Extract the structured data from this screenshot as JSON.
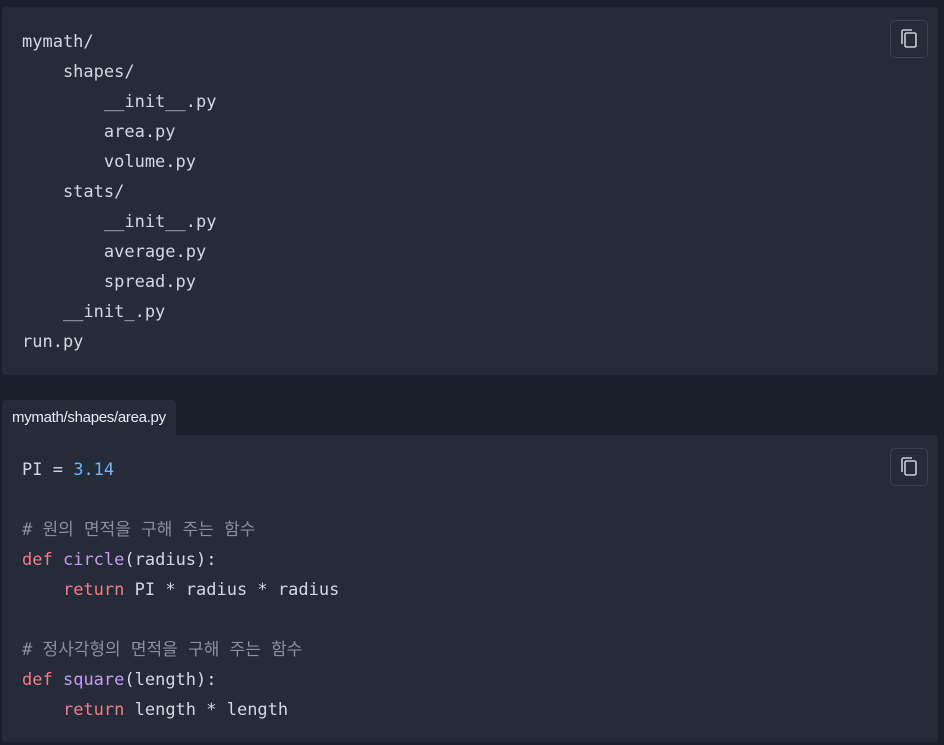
{
  "colors": {
    "background": "#1b1f2b",
    "block_background": "#262b39",
    "text": "#d3d7e0",
    "keyword": "#f47c86",
    "function_name": "#c59bf2",
    "number": "#6ab7f5",
    "comment": "#8a8f9c"
  },
  "tree_block": {
    "copy_icon": "copy-icon",
    "lines": [
      "mymath/",
      "    shapes/",
      "        __init__.py",
      "        area.py",
      "        volume.py",
      "    stats/",
      "        __init__.py",
      "        average.py",
      "        spread.py",
      "    __init_.py",
      "run.py"
    ]
  },
  "area_block": {
    "tab_label": "mymath/shapes/area.py",
    "copy_icon": "copy-icon",
    "code": {
      "line1": {
        "name": "PI",
        "op": " = ",
        "value": "3.14"
      },
      "comment1": "# 원의 면적을 구해 주는 함수",
      "def1": {
        "kw": "def",
        "fn": "circle",
        "params": "(radius):"
      },
      "ret1": {
        "indent": "    ",
        "kw": "return",
        "expr": " PI * radius * radius"
      },
      "comment2": "# 정사각형의 면적을 구해 주는 함수",
      "def2": {
        "kw": "def",
        "fn": "square",
        "params": "(length):"
      },
      "ret2": {
        "indent": "    ",
        "kw": "return",
        "expr": " length * length"
      }
    }
  }
}
